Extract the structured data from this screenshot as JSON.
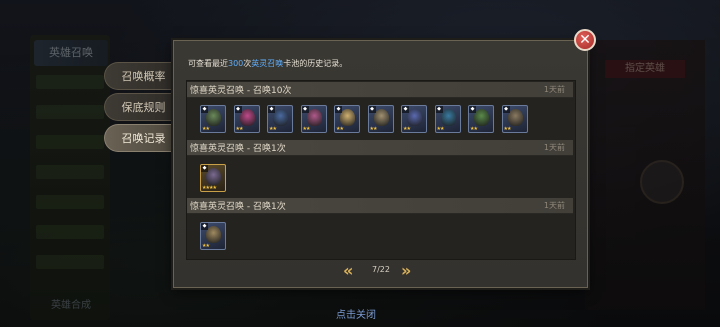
{
  "background": {
    "left_top_label": "英雄召唤",
    "left_bottom_label": "英雄合成",
    "right_tag": "指定英雄"
  },
  "tabs": [
    {
      "label": "召唤概率",
      "active": false
    },
    {
      "label": "保底规则",
      "active": false
    },
    {
      "label": "召唤记录",
      "active": true
    }
  ],
  "notice": {
    "prefix": "可查看最近",
    "count": "300",
    "mid": "次",
    "pool": "英灵召唤",
    "suffix": "卡池的历史记录。"
  },
  "records": [
    {
      "title": "惊喜英灵召唤 - 召唤10次",
      "time": "1天前",
      "cards": [
        {
          "rarity": "blue",
          "stars": "★★",
          "color": "#6a8a5a"
        },
        {
          "rarity": "blue",
          "stars": "★★",
          "color": "#c04a8a"
        },
        {
          "rarity": "blue",
          "stars": "★★",
          "color": "#4a6aa0"
        },
        {
          "rarity": "blue",
          "stars": "★★",
          "color": "#b05a8a"
        },
        {
          "rarity": "blue",
          "stars": "★★",
          "color": "#d0b070"
        },
        {
          "rarity": "blue",
          "stars": "★★",
          "color": "#a09070"
        },
        {
          "rarity": "blue",
          "stars": "★★",
          "color": "#5a6ab0"
        },
        {
          "rarity": "blue",
          "stars": "★★",
          "color": "#3a7aa0"
        },
        {
          "rarity": "blue",
          "stars": "★★",
          "color": "#5a8a4a"
        },
        {
          "rarity": "blue",
          "stars": "★★",
          "color": "#8a7a60"
        }
      ]
    },
    {
      "title": "惊喜英灵召唤 - 召唤1次",
      "time": "1天前",
      "cards": [
        {
          "rarity": "gold",
          "stars": "★★★★",
          "color": "#7a6a90"
        }
      ]
    },
    {
      "title": "惊喜英灵召唤 - 召唤1次",
      "time": "1天前",
      "cards": [
        {
          "rarity": "blue",
          "stars": "★★",
          "color": "#a08a60"
        }
      ]
    }
  ],
  "pager": {
    "prev_icon": "«",
    "next_icon": "»",
    "text": "7/22"
  },
  "footer": {
    "tap_close": "点击关闭"
  },
  "colors": {
    "accent_blue": "#5fb0ff",
    "gold": "#d8b25a",
    "close_red": "#c03a34"
  }
}
